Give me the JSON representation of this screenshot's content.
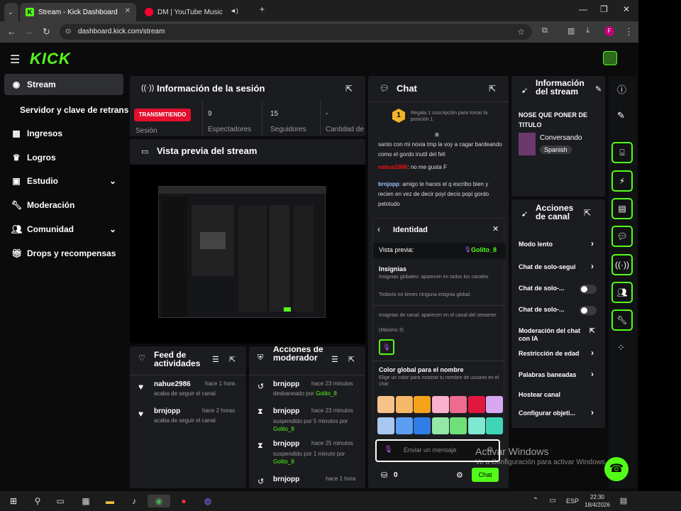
{
  "browser": {
    "tabs": [
      {
        "label": "Stream - Kick Dashboard",
        "active": true
      },
      {
        "label": "DM | YouTube Music",
        "active": false
      }
    ],
    "url": "dashboard.kick.com/stream",
    "profile_initial": "F"
  },
  "kick": {
    "logo": "KICK"
  },
  "sidebar": {
    "items": [
      {
        "label": "Stream",
        "active": true
      },
      {
        "label": "Servidor y clave de retransm"
      },
      {
        "label": "Ingresos"
      },
      {
        "label": "Logros"
      },
      {
        "label": "Estudio"
      },
      {
        "label": "Moderación"
      },
      {
        "label": "Comunidad"
      },
      {
        "label": "Drops y recompensas"
      }
    ]
  },
  "session": {
    "title": "Información de la sesión",
    "status_badge": "TRANSMITIENDO",
    "status_label": "Sesión",
    "spectators_value": "9",
    "spectators_label": "Espectadores",
    "followers_value": "15",
    "followers_label": "Seguidores",
    "amount_value": "-",
    "amount_label": "Cantidad de"
  },
  "preview": {
    "title": "Vista previa del stream"
  },
  "activity": {
    "title": "Feed de actividades",
    "items": [
      {
        "user": "nahue2986",
        "time": "hace 1 hora",
        "text": "acaba de seguir el canal"
      },
      {
        "user": "brnjopp",
        "time": "hace 2 horas",
        "text": "acaba de seguir el canal"
      }
    ]
  },
  "modactions": {
    "title": "Acciones de moderador",
    "items": [
      {
        "user": "brnjopp",
        "time": "hace 23 minutos",
        "text": "desbaneado por",
        "by": "Golito_8"
      },
      {
        "user": "brnjopp",
        "time": "hace 23 minutos",
        "text": "suspendido por 5 minutos por",
        "by": "Golito_8"
      },
      {
        "user": "brnjopp",
        "time": "hace 25 minutos",
        "text": "suspendido por 1 minuto por",
        "by": "Golito_8"
      },
      {
        "user": "brnjopp",
        "time": "hace 1 hora",
        "text": "",
        "by": ""
      }
    ]
  },
  "chat": {
    "title": "Chat",
    "gift_rank": "1",
    "gift_text": "Regala 1 suscripción para tomar la posición 1",
    "messages": [
      {
        "user": "",
        "text": "santo con mi novia tmp la voy a cagar bardeando como el gordo inutil del feli"
      },
      {
        "user": "nahue2986",
        "text": "no me gusta F"
      },
      {
        "user": "brnjopp",
        "text": "amigo te haces el q escribo bien y recien en vez de decir poyl decis popi gordo pelotudo"
      }
    ],
    "input_placeholder": "Enviar un mensaje",
    "points": "0",
    "send_label": "Chat"
  },
  "identity": {
    "title": "Identidad",
    "preview_label": "Vista previa:",
    "preview_name": "Golito_8",
    "badges_heading": "Insignias",
    "global_badges_desc": "Insignias globales: aparecen en todos los canales",
    "no_global_badges": "Todavía no tienes ninguna insignia global.",
    "channel_badges_desc": "Insignias de canal: aparecen en el canal del streamer",
    "channel_badges_max": "(Máximo 3)",
    "color_heading": "Color global para el nombre",
    "color_desc": "Elige un color para mostrar tu nombre de usuario en el chat",
    "swatches_row1": [
      "#f7c289",
      "#f5b866",
      "#f7a21b",
      "#f9b2cc",
      "#f06a8f",
      "#e1173f",
      "#d7a8f2"
    ],
    "swatches_row2": [
      "#a8c8f2",
      "#5d9ef2",
      "#2f7de6",
      "#93e8a8",
      "#6de07a",
      "#7fe8d0",
      "#3fd6b8"
    ]
  },
  "stream_info": {
    "title": "Información del stream",
    "stream_title": "NOSE QUE PONER DE TITULO",
    "category": "Conversando",
    "language": "Spanish"
  },
  "channel_actions": {
    "title": "Acciones de canal",
    "items": [
      {
        "label": "Modo lento"
      },
      {
        "label": "Chat de solo-segui"
      },
      {
        "label": "Chat de solo-..."
      },
      {
        "label": "Chat de solo-..."
      },
      {
        "label": "Moderación del chat con IA"
      },
      {
        "label": "Restricción de edad"
      },
      {
        "label": "Palabras baneadas"
      },
      {
        "label": "Hostear canal"
      },
      {
        "label": "Configurar objeti..."
      }
    ]
  },
  "watermark": {
    "line1": "Activar Windows",
    "line2": "Ve a Configuración para activar Windows."
  },
  "taskbar": {
    "lang": "ESP",
    "time": "22:30",
    "date": "18/4/2026"
  }
}
